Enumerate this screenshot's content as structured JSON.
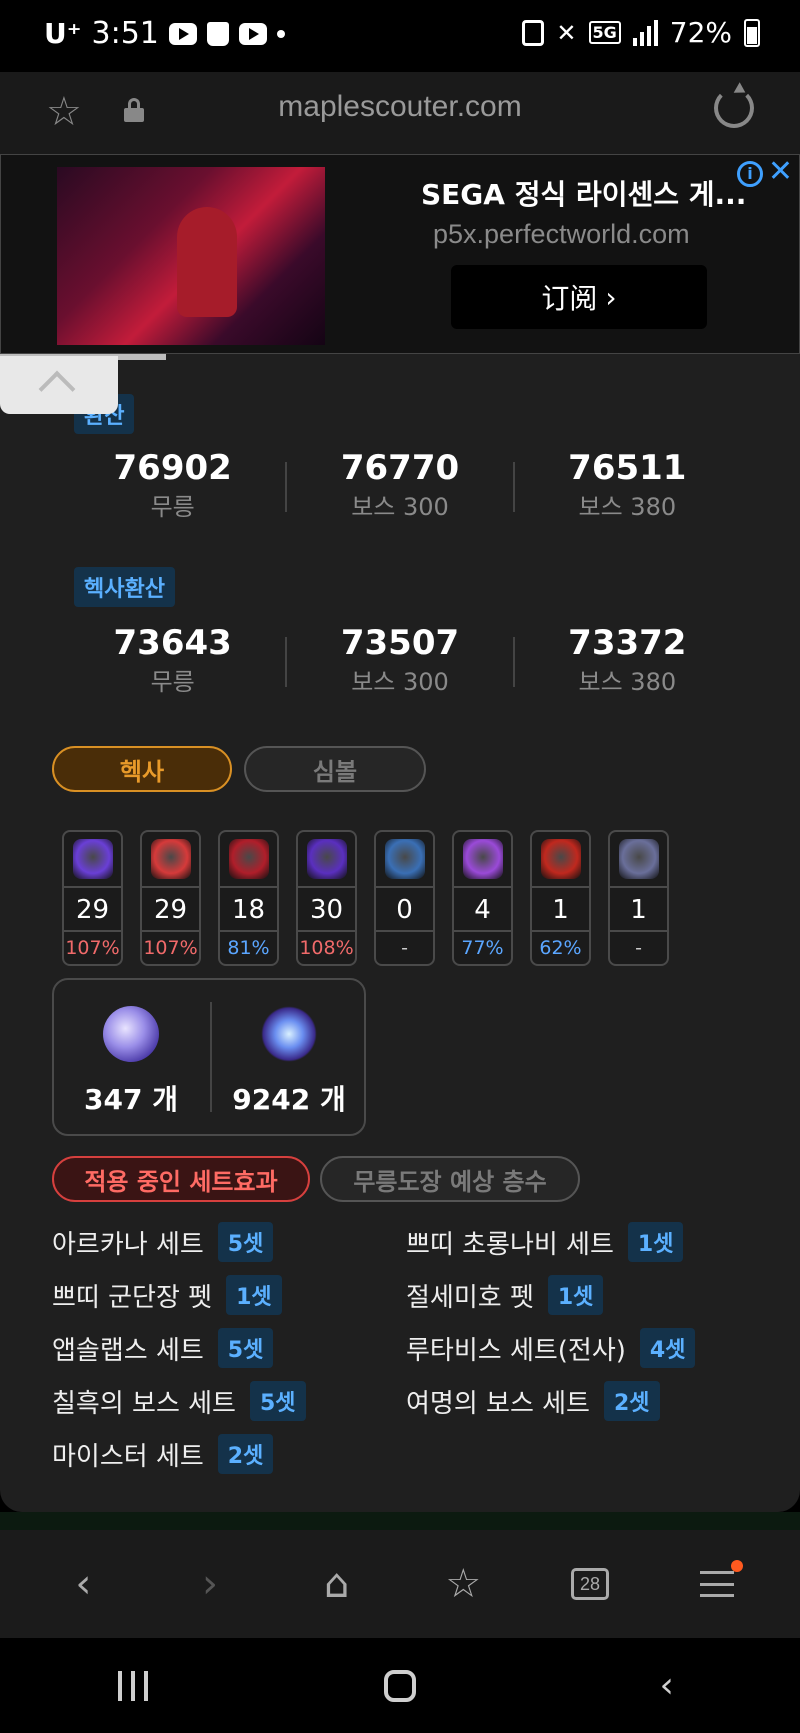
{
  "status_bar": {
    "carrier": "U⁺",
    "time": "3:51",
    "network": "5G",
    "battery": "72%"
  },
  "browser": {
    "url": "maplescouter.com",
    "tabs_count": "28"
  },
  "ad": {
    "title": "SEGA 정식 라이센스 게...",
    "domain": "p5x.perfectworld.com",
    "cta": "订阅",
    "info_glyph": "i",
    "close_glyph": "✕"
  },
  "stats": {
    "section1_tag": "환산",
    "section1": [
      {
        "value": "76902",
        "label": "무릉"
      },
      {
        "value": "76770",
        "label": "보스 300"
      },
      {
        "value": "76511",
        "label": "보스 380"
      }
    ],
    "section2_tag": "헥사환산",
    "section2": [
      {
        "value": "73643",
        "label": "무릉"
      },
      {
        "value": "73507",
        "label": "보스 300"
      },
      {
        "value": "73372",
        "label": "보스 380"
      }
    ]
  },
  "tabs": {
    "hexa": "헥사",
    "symbol": "심볼"
  },
  "skills": [
    {
      "level": "29",
      "pct": "107%",
      "pct_color": "#f06a6a",
      "icon_color": "#6a3fd6"
    },
    {
      "level": "29",
      "pct": "107%",
      "pct_color": "#f06a6a",
      "icon_color": "#d63a3a"
    },
    {
      "level": "18",
      "pct": "81%",
      "pct_color": "#5ba6ff",
      "icon_color": "#b01e2a"
    },
    {
      "level": "30",
      "pct": "108%",
      "pct_color": "#f06a6a",
      "icon_color": "#5a2fbf"
    },
    {
      "level": "0",
      "pct": "-",
      "pct_color": "#cccccc",
      "icon_color": "#3a6fb5"
    },
    {
      "level": "4",
      "pct": "77%",
      "pct_color": "#5ba6ff",
      "icon_color": "#9a4ad8"
    },
    {
      "level": "1",
      "pct": "62%",
      "pct_color": "#5ba6ff",
      "icon_color": "#c0281e"
    },
    {
      "level": "1",
      "pct": "-",
      "pct_color": "#cccccc",
      "icon_color": "#6a6f9a"
    }
  ],
  "fragments": [
    {
      "value": "347 개",
      "icon": "sol-erda-fragment-icon"
    },
    {
      "value": "9242 개",
      "icon": "sol-erda-icon"
    }
  ],
  "set_tabs": {
    "active": "적용 중인 세트효과",
    "inactive": "무릉도장 예상 층수"
  },
  "sets": [
    {
      "name": "아르카나 세트",
      "count": "5셋"
    },
    {
      "name": "쁘띠 초롱나비 세트",
      "count": "1셋"
    },
    {
      "name": "쁘띠 군단장 펫",
      "count": "1셋"
    },
    {
      "name": "절세미호 펫",
      "count": "1셋"
    },
    {
      "name": "앱솔랩스 세트",
      "count": "5셋"
    },
    {
      "name": "루타비스 세트(전사)",
      "count": "4셋"
    },
    {
      "name": "칠흑의 보스 세트",
      "count": "5셋"
    },
    {
      "name": "여명의 보스 세트",
      "count": "2셋"
    },
    {
      "name": "마이스터 세트",
      "count": "2셋"
    }
  ]
}
